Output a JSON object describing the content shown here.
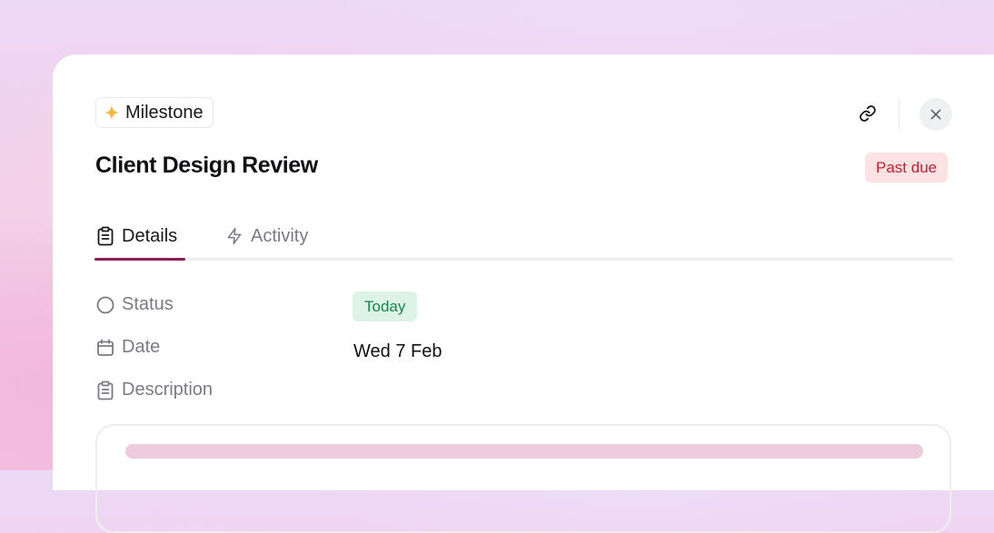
{
  "badge": {
    "label": "Milestone",
    "icon": "sparkle-icon"
  },
  "header": {
    "title": "Client Design Review",
    "status_badge": "Past due",
    "actions": {
      "link_icon": "link-icon",
      "close_icon": "close-icon"
    }
  },
  "tabs": [
    {
      "label": "Details",
      "icon": "clipboard-icon",
      "active": true
    },
    {
      "label": "Activity",
      "icon": "lightning-icon",
      "active": false
    }
  ],
  "fields": {
    "status": {
      "label": "Status",
      "icon": "circle-icon",
      "value": "Today"
    },
    "date": {
      "label": "Date",
      "icon": "calendar-icon",
      "value": "Wed 7 Feb"
    },
    "description": {
      "label": "Description",
      "icon": "clipboard-icon"
    }
  },
  "colors": {
    "accent": "#8b1e55",
    "past_due_bg": "#fde2e4",
    "past_due_text": "#c3202f",
    "today_bg": "#dcf3e6",
    "today_text": "#17864a",
    "sparkle": "#f5b942"
  }
}
